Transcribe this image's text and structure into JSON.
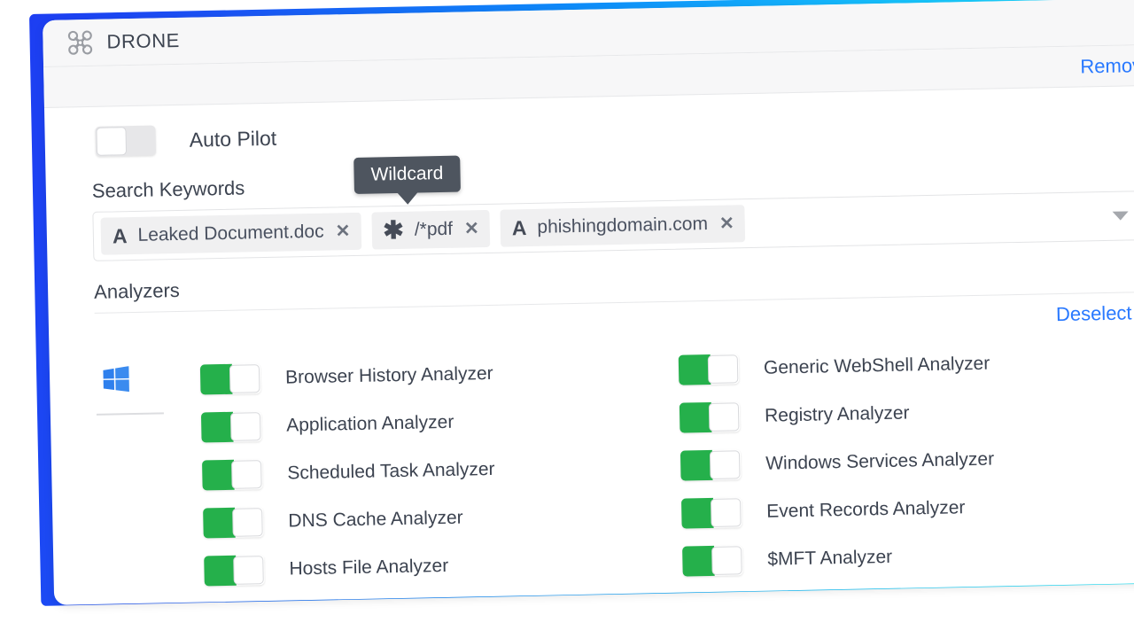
{
  "theme": {
    "gradient_start": "#1d3ef2",
    "gradient_end": "#25eafc",
    "link_color": "#2979ff",
    "toggle_on_color": "#25b04b",
    "tooltip_bg": "#4e555f",
    "windows_logo_color": "#2f80ed",
    "text_color": "#3c4350"
  },
  "card": {
    "title": "DRONE",
    "icon": "drone-icon",
    "remove_label": "Remove"
  },
  "auto_pilot": {
    "label": "Auto Pilot",
    "state": "off"
  },
  "search_keywords": {
    "section_label": "Search Keywords",
    "tooltip": "Wildcard",
    "caret_icon": "chevron-down-icon",
    "chips": [
      {
        "icon": "A",
        "icon_name": "literal-text-icon",
        "label": "Leaked Document.doc",
        "remove_icon": "✕"
      },
      {
        "icon": "✱",
        "icon_name": "wildcard-asterisk-icon",
        "label": "/*pdf",
        "remove_icon": "✕"
      },
      {
        "icon": "A",
        "icon_name": "literal-text-icon",
        "label": "phishingdomain.com",
        "remove_icon": "✕"
      }
    ]
  },
  "analyzers": {
    "section_label": "Analyzers",
    "deselect_label": "Deselect All",
    "os": {
      "name": "windows",
      "icon": "windows-logo-icon"
    },
    "left_column": [
      {
        "label": "Browser History Analyzer",
        "state": "on"
      },
      {
        "label": "Application Analyzer",
        "state": "on"
      },
      {
        "label": "Scheduled Task Analyzer",
        "state": "on"
      },
      {
        "label": "DNS Cache Analyzer",
        "state": "on"
      },
      {
        "label": "Hosts File Analyzer",
        "state": "on"
      }
    ],
    "right_column": [
      {
        "label": "Generic WebShell Analyzer",
        "state": "on"
      },
      {
        "label": "Registry Analyzer",
        "state": "on"
      },
      {
        "label": "Windows Services Analyzer",
        "state": "on"
      },
      {
        "label": "Event Records Analyzer",
        "state": "on"
      },
      {
        "label": "$MFT Analyzer",
        "state": "on"
      }
    ]
  }
}
